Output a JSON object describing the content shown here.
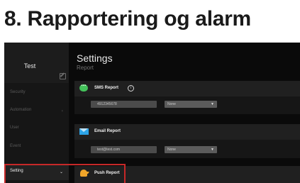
{
  "heading": "8. Rapportering og alarm",
  "sidebar": {
    "title": "Test",
    "items": [
      {
        "label": "Security",
        "chevron": ""
      },
      {
        "label": "Automation",
        "chevron": "›"
      },
      {
        "label": "User",
        "chevron": ""
      },
      {
        "label": "Event",
        "chevron": ""
      },
      {
        "label": "Setting",
        "chevron": "⌄"
      }
    ]
  },
  "main": {
    "title": "Settings",
    "subtitle": "Report",
    "sms": {
      "title": "SMS Report",
      "info": "i",
      "phone": "4912345678",
      "select": "None"
    },
    "email": {
      "title": "Email Report",
      "address": "test@test.com",
      "select": "None"
    },
    "push": {
      "title": "Push Report"
    }
  },
  "colors": {
    "sms_icon": "#44c35b",
    "mail_icon": "#2da4e8",
    "push_icon": "#f0a52a",
    "highlight": "#c62828"
  }
}
